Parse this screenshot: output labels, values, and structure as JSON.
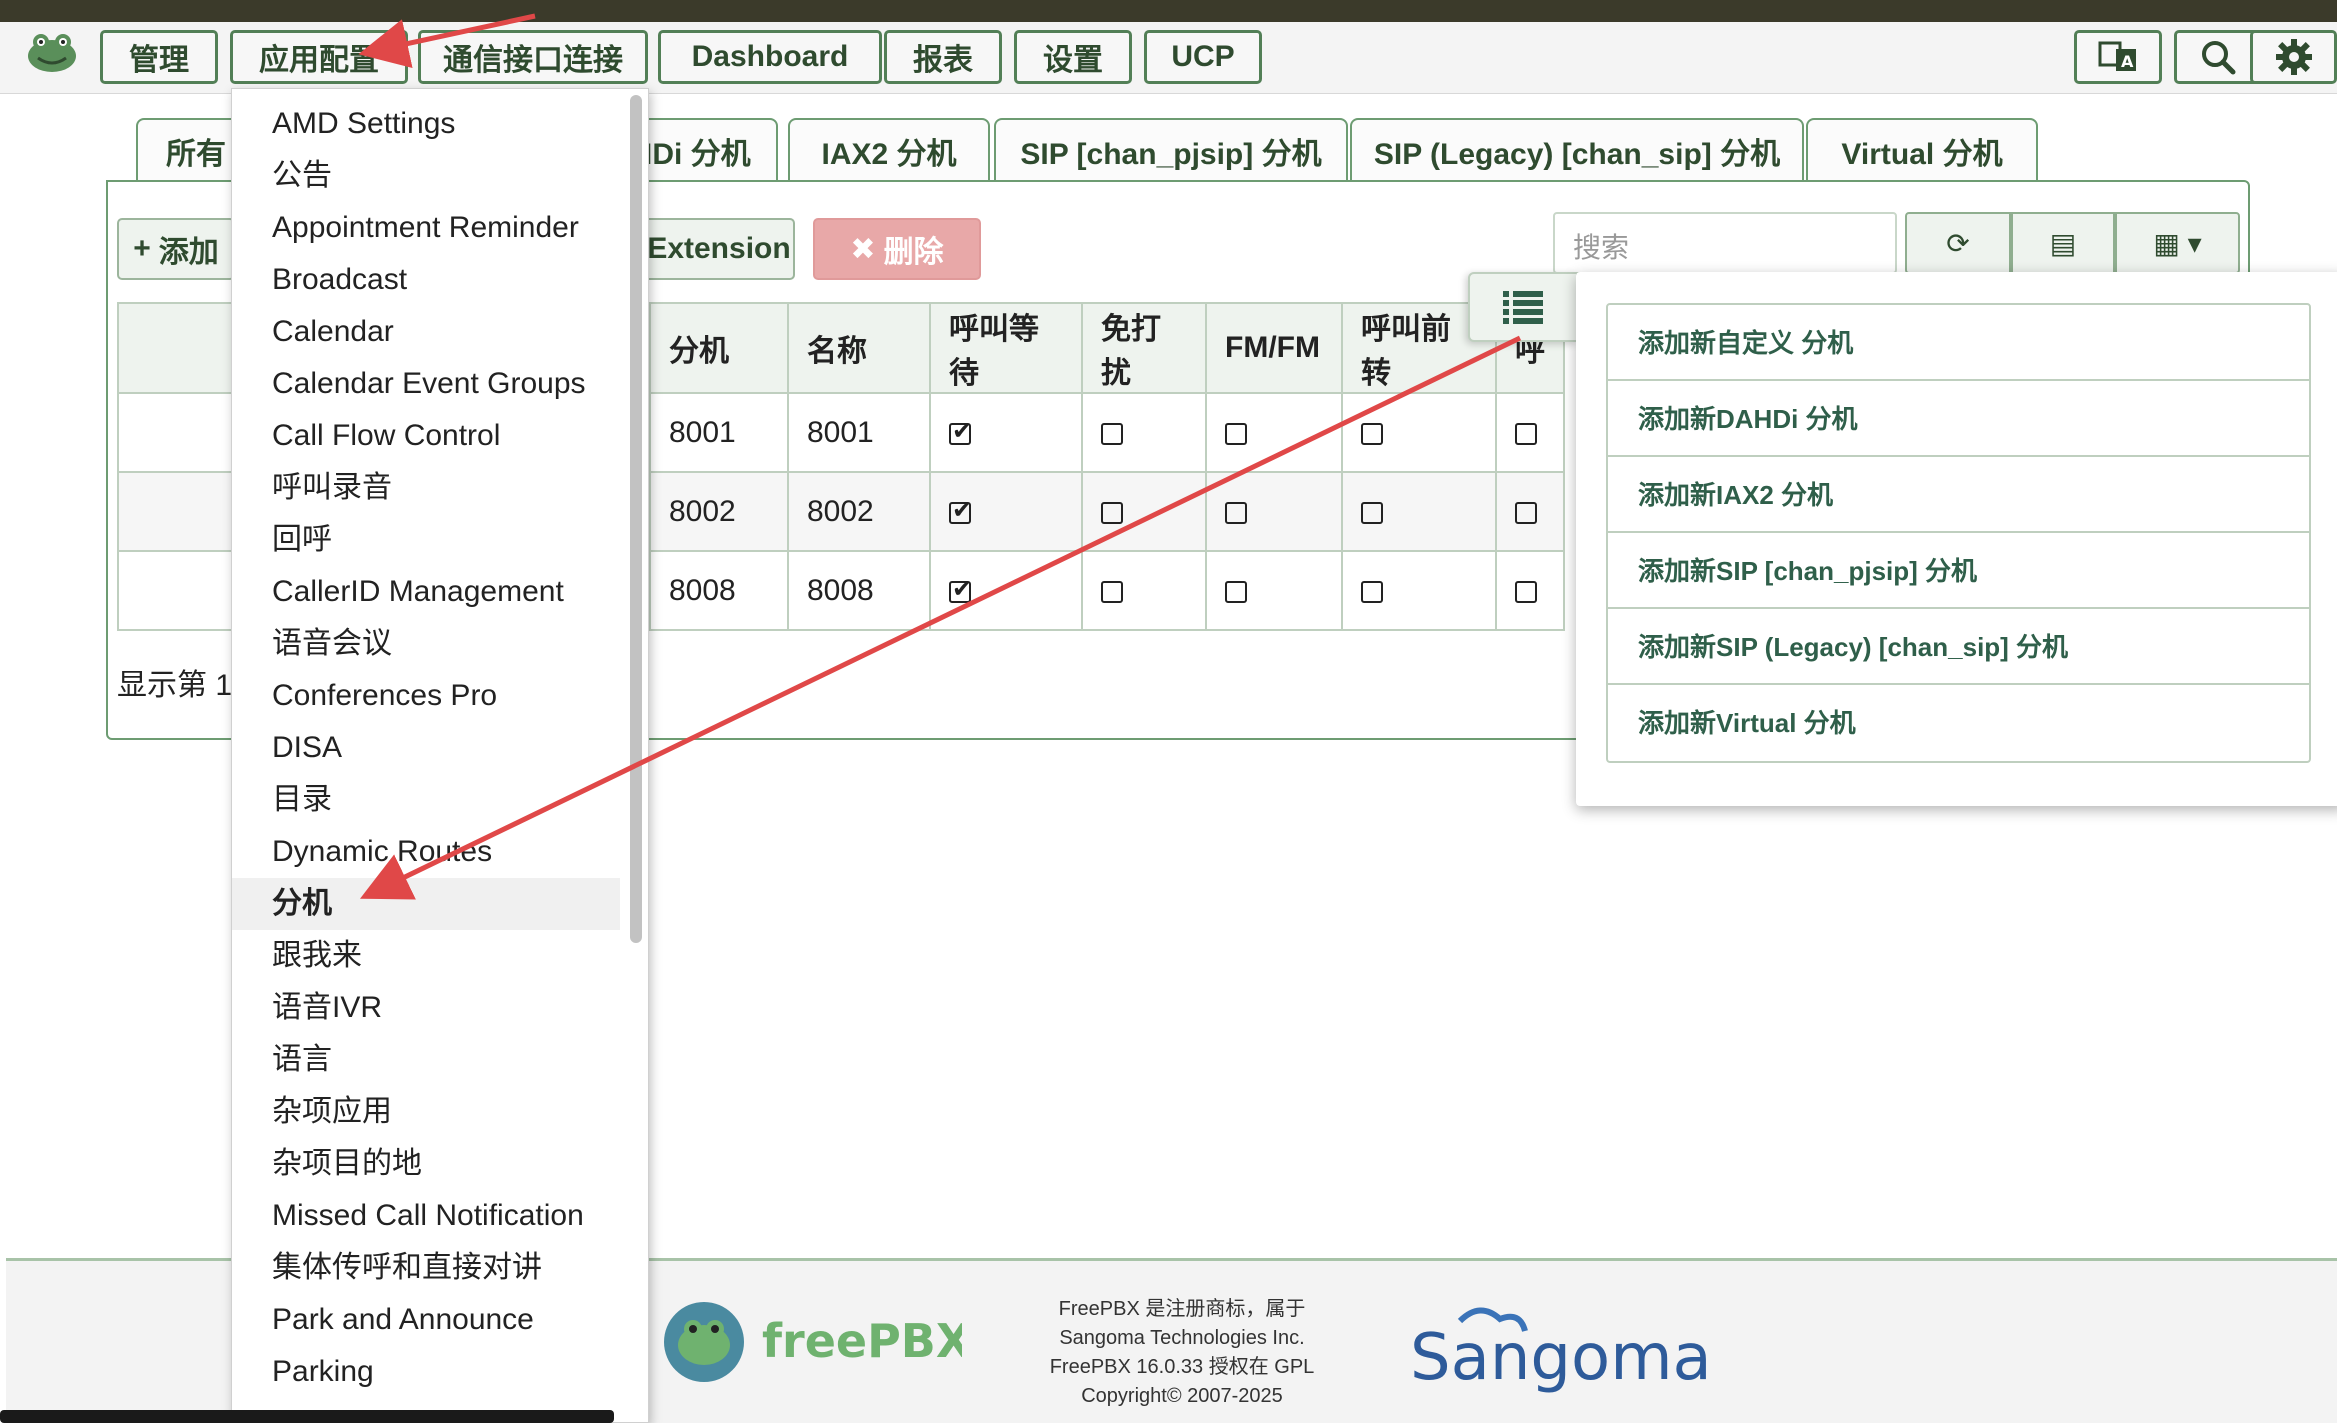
{
  "nav": {
    "items": [
      "管理",
      "应用配置",
      "通信接口连接",
      "Dashboard",
      "报表",
      "设置",
      "UCP"
    ],
    "icons": [
      "translate-icon",
      "search-icon",
      "gear-icon"
    ]
  },
  "tabs": [
    "所有",
    "DAHDi 分机",
    "IAX2 分机",
    "SIP [chan_pjsip] 分机",
    "SIP (Legacy) [chan_sip] 分机",
    "Virtual 分机"
  ],
  "tab_visible_labels": {
    "all": "所有",
    "dahdi": "DAHDi 分机"
  },
  "toolbar": {
    "add_label": "添加",
    "extension_label": "Extension",
    "delete_label": "删除",
    "search_placeholder": "搜索"
  },
  "table": {
    "headers": [
      "分机",
      "名称",
      "呼叫等待",
      "免打扰",
      "FM/FM",
      "呼叫前转",
      "呼"
    ],
    "rows": [
      {
        "ext": "8001",
        "name": "8001",
        "cw": true,
        "dnd": false,
        "fmfm": false,
        "cf": false,
        "col7": false
      },
      {
        "ext": "8002",
        "name": "8002",
        "cw": true,
        "dnd": false,
        "fmfm": false,
        "cf": false,
        "col7": false
      },
      {
        "ext": "8008",
        "name": "8008",
        "cw": true,
        "dnd": false,
        "fmfm": false,
        "cf": false,
        "col7": false
      }
    ]
  },
  "showing_text": "显示第 1",
  "dropdown_menu": [
    "AMD Settings",
    "公告",
    "Appointment Reminder",
    "Broadcast",
    "Calendar",
    "Calendar Event Groups",
    "Call Flow Control",
    "呼叫录音",
    "回呼",
    "CallerID Management",
    "语音会议",
    "Conferences Pro",
    "DISA",
    "目录",
    "Dynamic Routes",
    "分机",
    "跟我来",
    "语音IVR",
    "语言",
    "杂项应用",
    "杂项目的地",
    "Missed Call Notification",
    "集体传呼和直接对讲",
    "Park and Announce",
    "Parking"
  ],
  "dropdown_active": "分机",
  "add_menu": [
    "添加新自定义 分机",
    "添加新DAHDi 分机",
    "添加新IAX2 分机",
    "添加新SIP [chan_pjsip] 分机",
    "添加新SIP (Legacy) [chan_sip] 分机",
    "添加新Virtual 分机"
  ],
  "footer": {
    "line1": "FreePBX 是注册商标，属于",
    "line2": "Sangoma Technologies Inc.",
    "line3": "FreePBX 16.0.33 授权在 GPL",
    "line4": "Copyright© 2007-2025",
    "freepbx_logo_text": "freePBX",
    "sangoma_logo_text": "Sangoma"
  },
  "colors": {
    "accent_green": "#527f56",
    "annotation_red": "#e04848",
    "delete_button": "#e8a8a8"
  }
}
